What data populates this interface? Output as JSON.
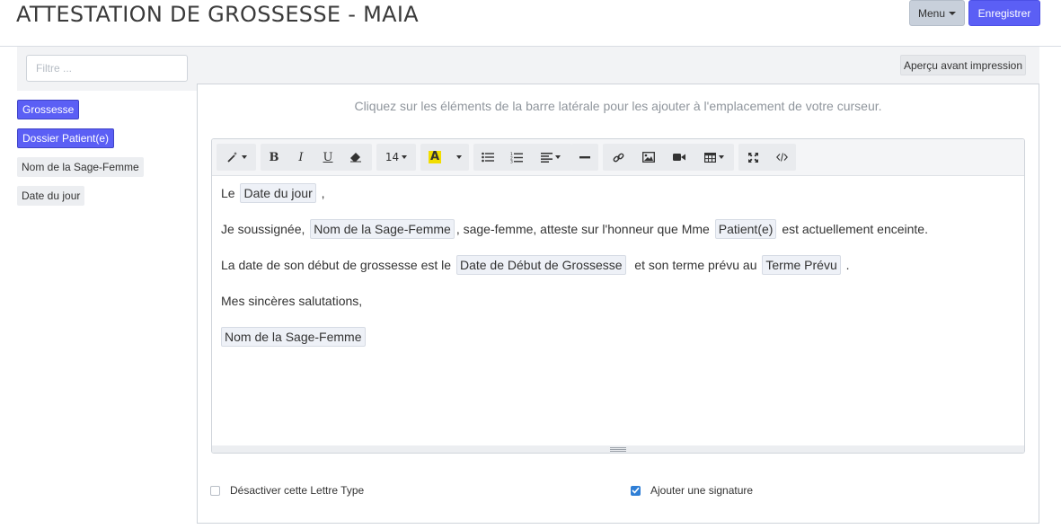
{
  "header": {
    "title": "ATTESTATION DE GROSSESSE - MAIA",
    "menu_label": "Menu",
    "save_label": "Enregistrer"
  },
  "sidebar": {
    "filter_placeholder": "Filtre ...",
    "tags": [
      {
        "label": "Grossesse",
        "style": "primary"
      },
      {
        "label": "Dossier Patient(e)",
        "style": "primary"
      },
      {
        "label": "Nom de la Sage-Femme",
        "style": "plain"
      },
      {
        "label": "Date du jour",
        "style": "plain"
      }
    ]
  },
  "main": {
    "preview_label": "Aperçu avant impression",
    "hint": "Cliquez sur les éléments de la barre latérale pour les ajouter à l'emplacement de votre curseur."
  },
  "toolbar": {
    "font_size": "14",
    "icons": [
      "magic-icon",
      "bold-icon",
      "italic-icon",
      "underline-icon",
      "eraser-icon",
      "font-size-select",
      "font-color-icon",
      "color-dropdown",
      "bullet-list-icon",
      "ordered-list-icon",
      "align-icon",
      "horizontal-rule-icon",
      "link-icon",
      "image-icon",
      "video-icon",
      "table-icon",
      "fullscreen-icon",
      "code-view-icon"
    ],
    "bold": "B",
    "italic": "I",
    "underline": "U",
    "font_color": "A",
    "highlight_color": "#f1dd00"
  },
  "document": {
    "line1": {
      "pre": "Le",
      "chip": "Date du jour",
      "post": ","
    },
    "line2": {
      "pre": "Je soussignée,",
      "chip1": "Nom de la Sage-Femme",
      "mid": ", sage-femme, atteste sur l'honneur que Mme",
      "chip2": "Patient(e)",
      "post": "est actuellement enceinte."
    },
    "line3": {
      "pre": "La date de son début de grossesse est le",
      "chip1": "Date de Début de Grossesse",
      "mid": "et son terme prévu au",
      "chip2": "Terme Prévu",
      "post": "."
    },
    "line4": "Mes sincères salutations,",
    "line5_chip": "Nom de la Sage-Femme"
  },
  "options": {
    "disable_label": "Désactiver cette Lettre Type",
    "disable_checked": false,
    "signature_label": "Ajouter une signature",
    "signature_checked": true
  },
  "colors": {
    "primary": "#5b5ff5",
    "menu_button": "#c8d0db",
    "checkbox_checked": "#2f7fd6"
  }
}
